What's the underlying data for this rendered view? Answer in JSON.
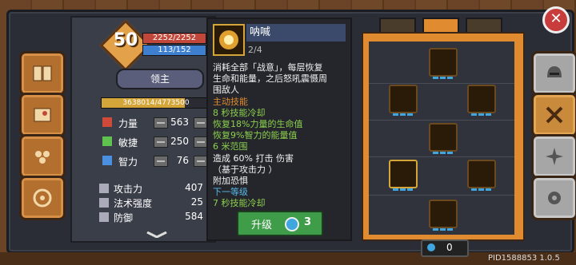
{
  "character": {
    "level": "50",
    "hp": "2252/2252",
    "mp": "113/152",
    "hp_ratio": 1.0,
    "mp_ratio": 0.743,
    "role": "领主",
    "xp": "3638014/4773500",
    "xp_ratio": 0.762
  },
  "attributes": [
    {
      "label": "力量",
      "value": "563",
      "icon": "fist-icon",
      "color": "#d04a3a"
    },
    {
      "label": "敏捷",
      "value": "250",
      "icon": "feather-icon",
      "color": "#5fc24f"
    },
    {
      "label": "智力",
      "value": "76",
      "icon": "book-icon",
      "color": "#4a8fe0"
    }
  ],
  "derived": [
    {
      "label": "攻击力",
      "value": "407",
      "icon": "sword-icon"
    },
    {
      "label": "法术强度",
      "value": "25",
      "icon": "wand-icon"
    },
    {
      "label": "防御",
      "value": "584",
      "icon": "shield-icon"
    }
  ],
  "skill": {
    "name": "呐喊",
    "level": "2/4",
    "lines": [
      {
        "t": "消耗全部「战意」，每层恢复",
        "c": "c-white"
      },
      {
        "t": "生命和能量，之后怒吼震慑周",
        "c": "c-white"
      },
      {
        "t": "围敌人",
        "c": "c-white"
      },
      {
        "t": "主动技能",
        "c": "c-orange"
      },
      {
        "t": "8 秒技能冷却",
        "c": "c-green"
      },
      {
        "t": "恢复18%力量的生命值",
        "c": "c-green"
      },
      {
        "t": "恢复9%智力的能量值",
        "c": "c-green"
      },
      {
        "t": "6 米范围",
        "c": "c-green"
      },
      {
        "t": "造成 60% 打击 伤害",
        "c": "c-white"
      },
      {
        "t": "（基于攻击力 ）",
        "c": "c-white"
      },
      {
        "t": "附加恐惧",
        "c": "c-white"
      },
      {
        "t": "",
        "c": "c-white"
      },
      {
        "t": "下一等级",
        "c": "c-blue"
      },
      {
        "t": "7 秒技能冷却",
        "c": "c-green"
      }
    ],
    "upgrade_label": "升级",
    "upgrade_cost": "3"
  },
  "currency": "0",
  "pid": "PID1588853 1.0.5",
  "close_label": "✕"
}
